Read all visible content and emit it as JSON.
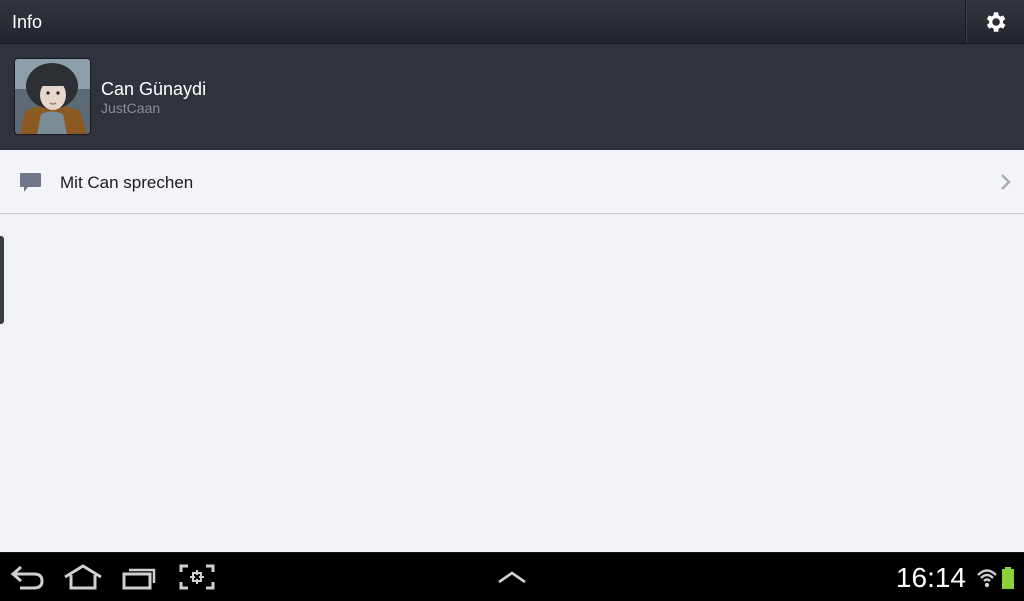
{
  "header": {
    "title": "Info",
    "settings_icon": "gear-icon"
  },
  "profile": {
    "name": "Can Günaydi",
    "handle": "JustCaan",
    "avatar_icon": "avatar"
  },
  "actions": [
    {
      "label": "Mit Can sprechen",
      "icon": "chat-bubble-icon",
      "chevron": "chevron-right-icon"
    }
  ],
  "statusbar": {
    "time": "16:14",
    "nav_icons": [
      "back-icon",
      "home-icon",
      "recent-apps-icon",
      "screenshot-icon",
      "up-arrow-icon"
    ],
    "wifi_icon": "wifi-icon",
    "battery_icon": "battery-icon",
    "battery_color": "#8bd13b"
  },
  "colors": {
    "titlebar": "#2b2d35",
    "profile_bg": "#31333c",
    "content_bg": "#f2f3f6",
    "navbar": "#000000"
  }
}
